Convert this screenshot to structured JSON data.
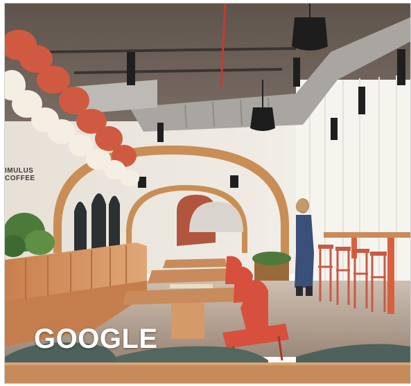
{
  "caption": {
    "text": "GOOGLE"
  },
  "wall_sign": {
    "line1": "IMULUS",
    "line2": "COFFEE"
  },
  "colors": {
    "ceiling": "#6e6259",
    "duct": "#a8a4a0",
    "wall": "#e9e4dc",
    "arch": "#c98e55",
    "banquette": "#d19261",
    "chairs": "#d8503d",
    "stools": "#c85a45",
    "floor": "#bba896",
    "curtain": "#f3f1ec",
    "pendant": "#1f1f1f",
    "light_balls": "#f5efe3",
    "red_cushion": "#d05a40",
    "green_seat": "#4d625c",
    "table_wood": "#c78a5b"
  }
}
